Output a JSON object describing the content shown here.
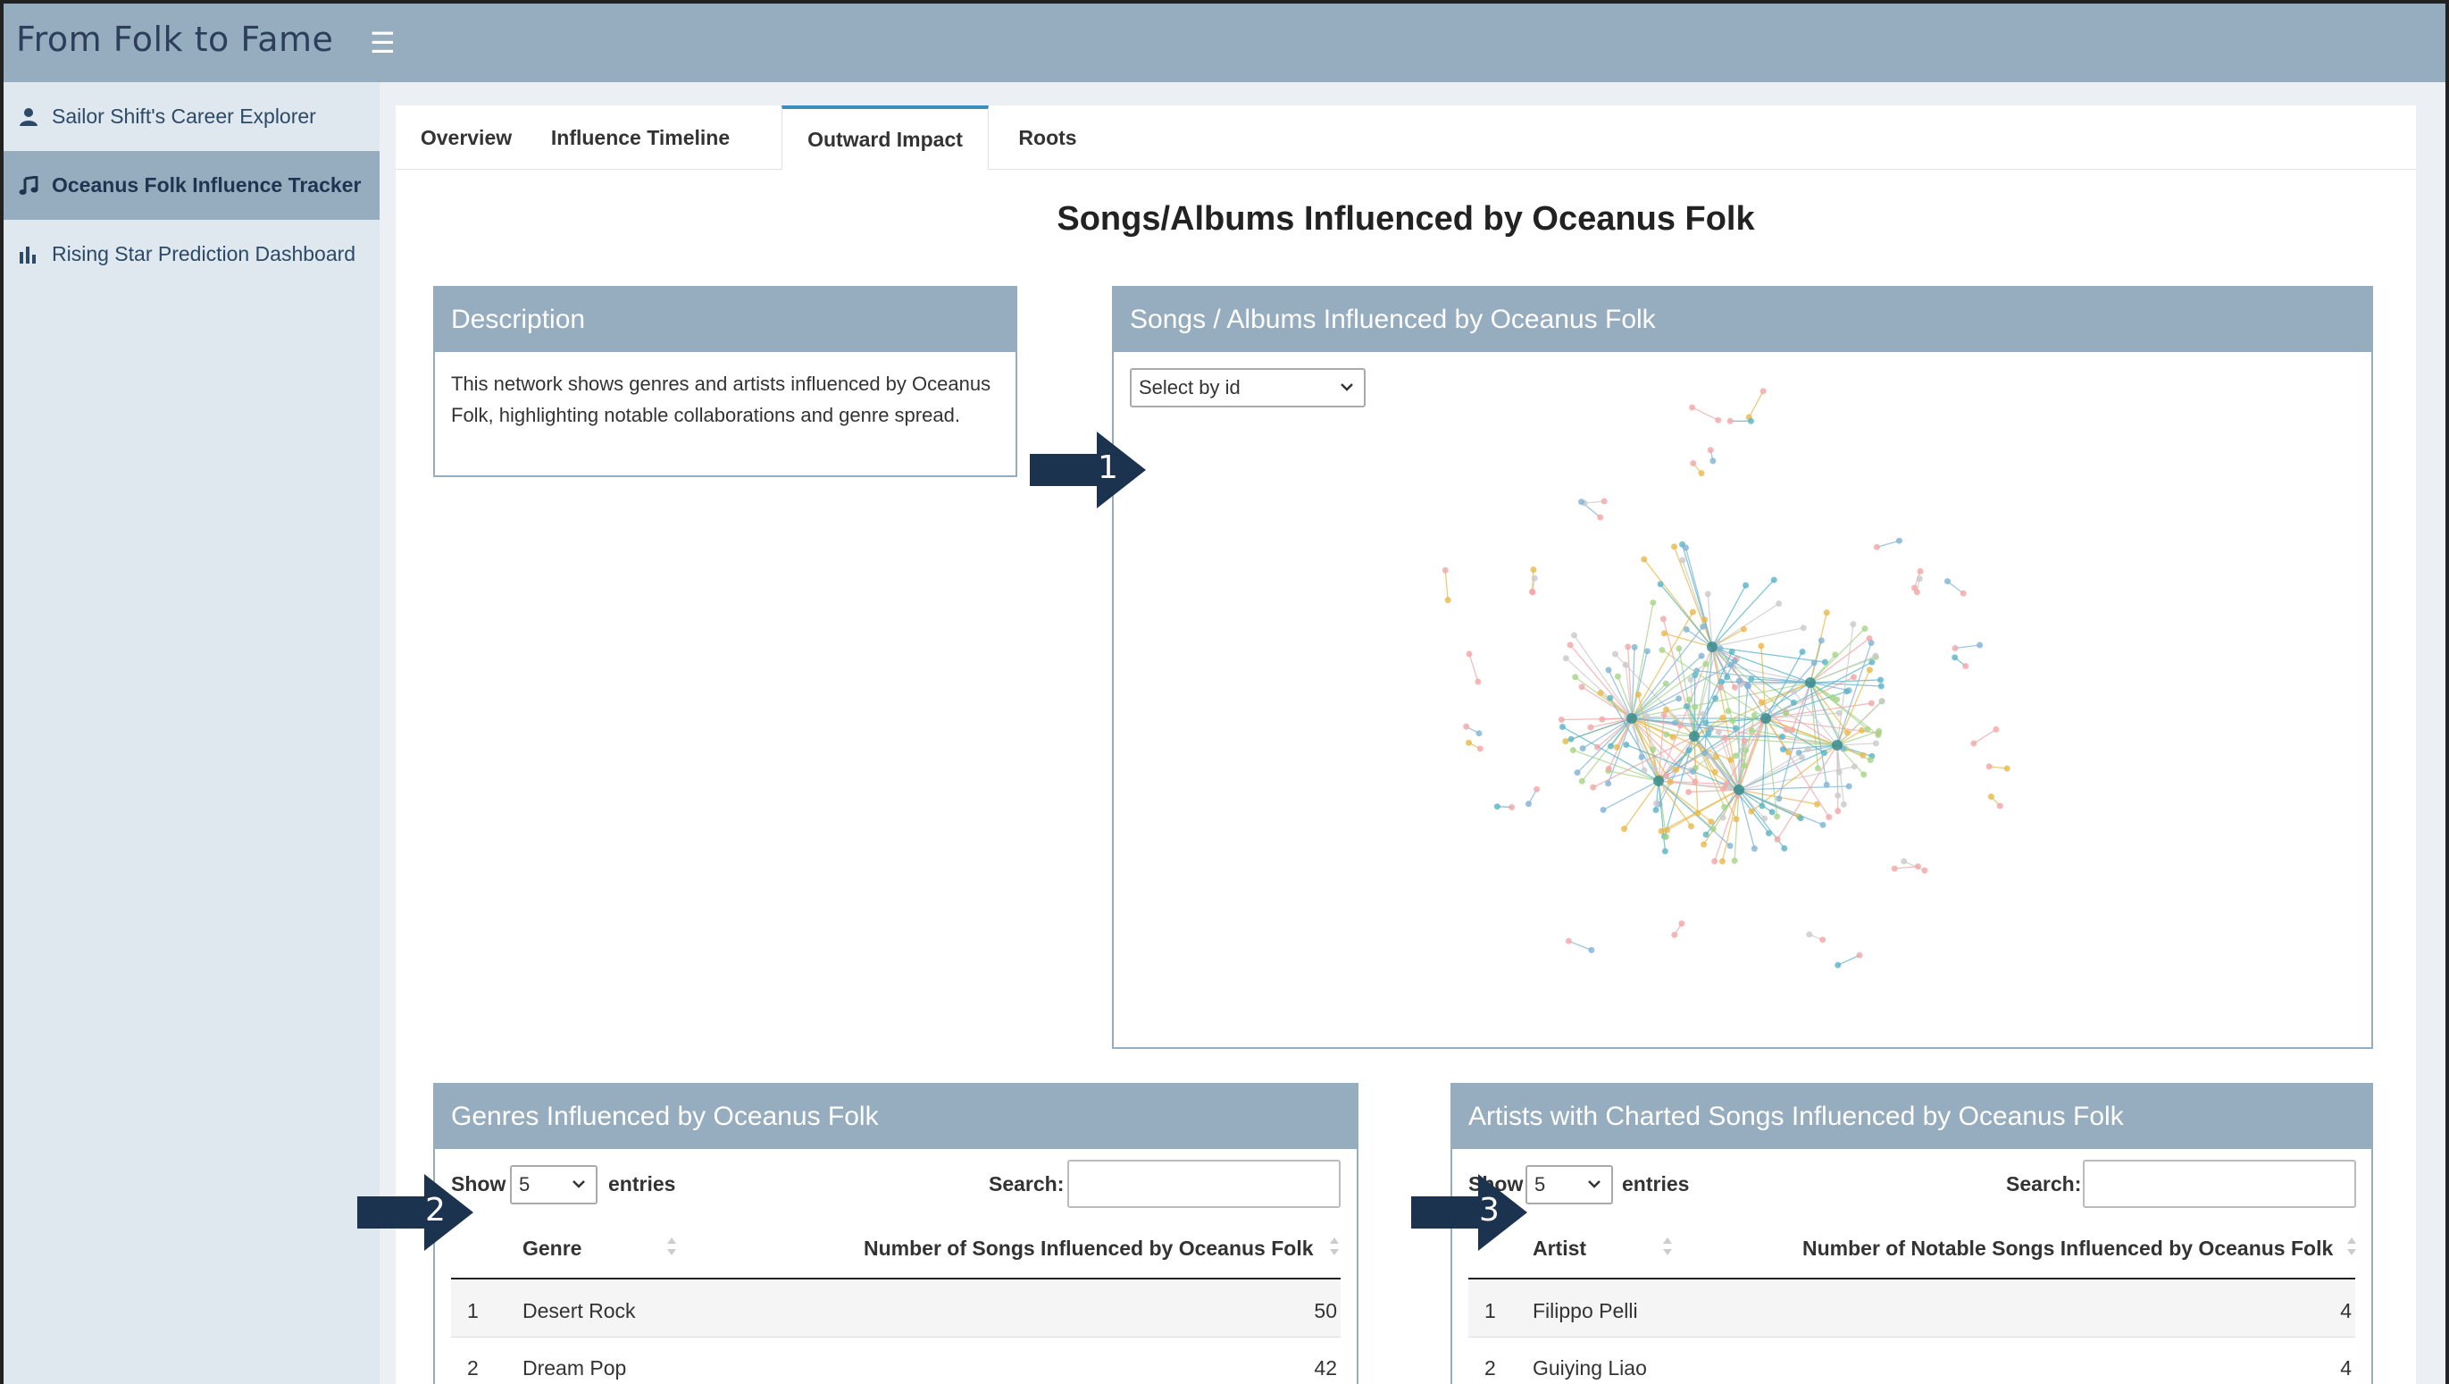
{
  "app": {
    "title": "From Folk to Fame"
  },
  "sidebar": {
    "items": [
      {
        "label": "Sailor Shift's Career Explorer",
        "icon": "user-icon"
      },
      {
        "label": "Oceanus Folk Influence Tracker",
        "icon": "music-note-icon",
        "active": true
      },
      {
        "label": "Rising Star Prediction Dashboard",
        "icon": "bar-chart-icon"
      }
    ]
  },
  "tabs": [
    {
      "label": "Overview"
    },
    {
      "label": "Influence Timeline"
    },
    {
      "label": "Outward Impact",
      "active": true
    },
    {
      "label": "Roots"
    }
  ],
  "page": {
    "title": "Songs/Albums Influenced by Oceanus Folk"
  },
  "description": {
    "header": "Description",
    "text": "This network shows genres and artists influenced by Oceanus Folk, highlighting notable collaborations and genre spread."
  },
  "network": {
    "header": "Songs / Albums Influenced by Oceanus Folk",
    "select_placeholder": "Select by id"
  },
  "genres_table": {
    "header": "Genres Influenced by Oceanus Folk",
    "show_label": "Show",
    "entries_value": "5",
    "entries_label": "entries",
    "search_label": "Search:",
    "columns": [
      "Genre",
      "Number of Songs Influenced by Oceanus Folk"
    ],
    "rows": [
      {
        "idx": "1",
        "name": "Desert Rock",
        "count": "50"
      },
      {
        "idx": "2",
        "name": "Dream Pop",
        "count": "42"
      }
    ]
  },
  "artists_table": {
    "header": "Artists with Charted Songs Influenced by Oceanus Folk",
    "show_label": "Show",
    "entries_value": "5",
    "entries_label": "entries",
    "search_label": "Search:",
    "columns": [
      "Artist",
      "Number of Notable Songs Influenced by Oceanus Folk"
    ],
    "rows": [
      {
        "idx": "1",
        "name": "Filippo Pelli",
        "count": "4"
      },
      {
        "idx": "2",
        "name": "Guiying Liao",
        "count": "4"
      }
    ]
  },
  "callouts": [
    "1",
    "2",
    "3"
  ],
  "colors": {
    "header_bar": "#95adbe",
    "callout": "#1c3350",
    "accent": "#3c8dbc"
  }
}
